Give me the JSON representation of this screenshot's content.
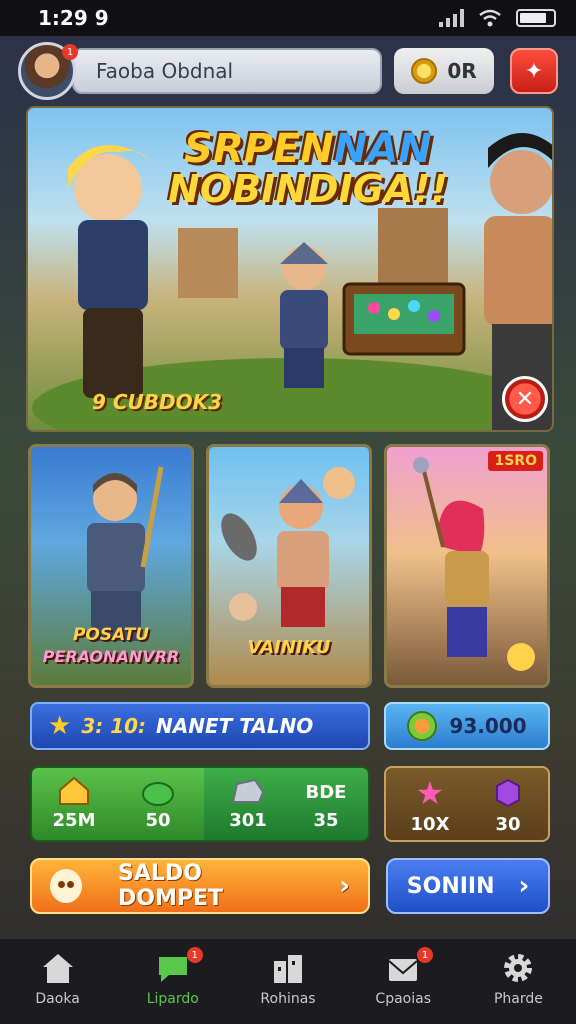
{
  "status_bar": {
    "time": "1:29 9"
  },
  "top_bar": {
    "player_name": "Faoba Obdnal",
    "avatar_badge": "1",
    "coins": "0R"
  },
  "banner": {
    "title_line1_a": "SRPEN",
    "title_line1_b": "NAN",
    "title_line2": "NOBINDIGA!!",
    "caption": "9 CUBDOK3"
  },
  "cards": [
    {
      "label_line1": "POSATU",
      "label_line2": "PERAONANVRR",
      "badge": ""
    },
    {
      "label_line1": "VAINIKU",
      "label_line2": "",
      "badge": ""
    },
    {
      "label_line1": "",
      "label_line2": "",
      "badge": "1SRO"
    }
  ],
  "reward_bar": {
    "amount": "3: 10:",
    "text": "NANET  TALNO"
  },
  "gems": {
    "value": "93.000"
  },
  "stats": {
    "cells": [
      {
        "value": "25M"
      },
      {
        "value": "50"
      },
      {
        "value": "301"
      },
      {
        "value": "35",
        "header": "BDE"
      }
    ]
  },
  "shop": {
    "left": "10X",
    "right": "30"
  },
  "wallet_button": {
    "label": "SALDO  DOMPET"
  },
  "join_button": {
    "label": "SONIIN"
  },
  "nav": {
    "items": [
      {
        "label": "Daoka",
        "badge": ""
      },
      {
        "label": "Lipardo",
        "badge": "1"
      },
      {
        "label": "Rohinas",
        "badge": ""
      },
      {
        "label": "Cpaoias",
        "badge": "1"
      },
      {
        "label": "Pharde",
        "badge": ""
      }
    ]
  },
  "colors": {
    "accent_orange": "#f0701a",
    "accent_blue": "#1f47b0",
    "accent_green": "#2f8a2a",
    "alert_red": "#e53a2a"
  }
}
